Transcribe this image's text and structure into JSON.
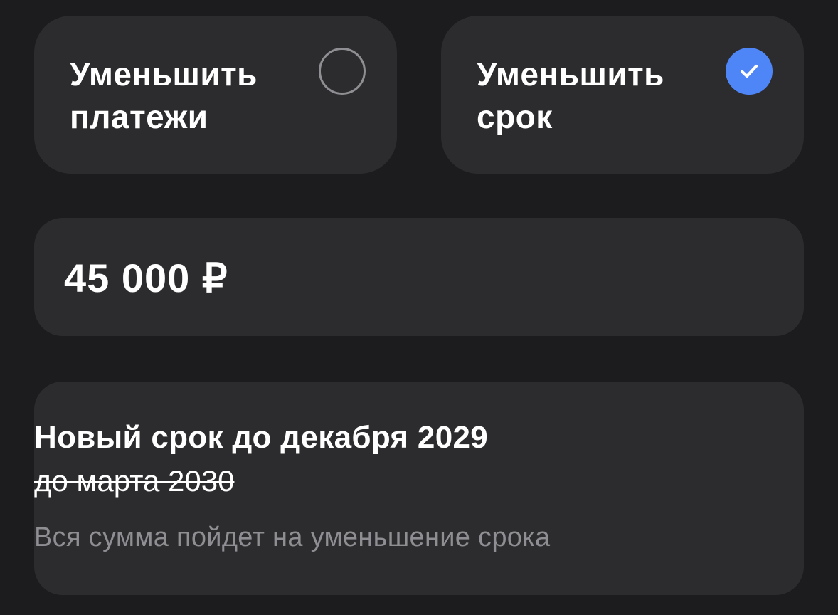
{
  "options": [
    {
      "label": "Уменьшить\nплатежи",
      "selected": false
    },
    {
      "label": "Уменьшить\nсрок",
      "selected": true
    }
  ],
  "amount": {
    "value": "45 000 ₽"
  },
  "info": {
    "new_term": "Новый срок до декабря 2029",
    "old_term": "до марта 2030",
    "hint": "Вся сумма пойдет на уменьшение срока"
  },
  "colors": {
    "background": "#1c1c1e",
    "card": "#2c2c2e",
    "accent": "#4f86f7",
    "secondary_text": "#8e8e93"
  },
  "icons": {
    "unselected": "radio-empty-icon",
    "selected": "checkmark-icon"
  }
}
